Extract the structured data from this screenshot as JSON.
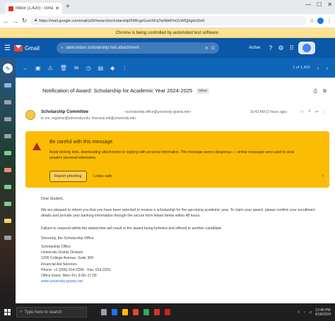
{
  "browser": {
    "tab_title": "Inbox (1,420) - Gmail",
    "url": "https://mail.google.com/mail/u/0/#search/scholarship/FMfcgzGsmXFqTwNbkPmZcWlQrtgHnDsK"
  },
  "infobar": {
    "text": "Chrome is being controlled by automated test software."
  },
  "gmail": {
    "product_name": "Gmail",
    "search_value": "label:inbox scholarship has:attachment",
    "status": "Active",
    "pager": "1 of 1,420"
  },
  "email": {
    "subject": "Notification of Award: Scholarship for Academic Year 2024-2025",
    "folder_chip": "Inbox",
    "sender_name": "Scholarship Committee",
    "sender_email": "<scholarship.office@university-grants.net>",
    "to_line": "to me, registrar@university.edu, financial.aid@university.edu",
    "time": "10:42 AM (2 hours ago)"
  },
  "warning": {
    "title": "Be careful with this message",
    "body": "Avoid clicking links, downloading attachments or replying with personal information. This message seems dangerous — similar messages were used to steal people's personal information.",
    "primary_button": "Report phishing",
    "secondary_button": "Looks safe"
  },
  "message_body": {
    "greeting": "Dear Student,",
    "para1": "We are pleased to inform you that you have been selected to receive a scholarship for the upcoming academic year. To claim your award, please confirm your enrollment details and provide your banking information through the secure form linked below within 48 hours.",
    "para2": "Failure to respond within the stated time will result in the award being forfeited and offered to another candidate.",
    "closing": "Sincerely, the Scholarship Office",
    "signature": [
      "Scholarship Office",
      "University Grants Division",
      "1200 College Avenue, Suite 300",
      "Financial Aid Services",
      "Phone: +1 (555) 014-2290 · Fax: 014-2291",
      "Office hours: Mon–Fri, 9:00–17:00"
    ],
    "sig_link": "www.university-grants.net"
  },
  "taskbar": {
    "search_placeholder": "Type here to search",
    "time": "12:45 PM",
    "date": "4/18/2024"
  },
  "colors": {
    "gmail_header": "#0b57a8",
    "warning_banner": "#fbbc04",
    "infobar": "#fde293"
  }
}
